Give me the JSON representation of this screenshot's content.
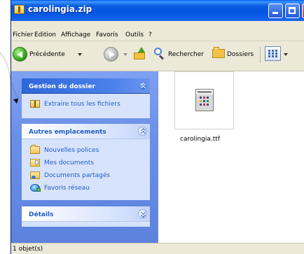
{
  "window": {
    "title": "carolingia.zip"
  },
  "menu": {
    "items": [
      "Fichier",
      "Edition",
      "Affichage",
      "Favoris",
      "Outils",
      "?"
    ]
  },
  "toolbar": {
    "back_label": "Précédente",
    "search_label": "Rechercher",
    "folders_label": "Dossiers"
  },
  "tasks": {
    "gestion_title": "Gestion du dossier",
    "gestion_items": [
      {
        "label": "Extraire tous les fichiers",
        "icon": "zip-folder-icon"
      }
    ],
    "autres_title": "Autres emplacements",
    "autres_items": [
      {
        "label": "Nouvelles polices",
        "icon": "folder-icon"
      },
      {
        "label": "Mes documents",
        "icon": "documents-folder-icon"
      },
      {
        "label": "Documents partagés",
        "icon": "shared-folder-icon"
      },
      {
        "label": "Favoris réseau",
        "icon": "network-places-icon"
      }
    ],
    "details_title": "Détails"
  },
  "main": {
    "file_name": "carolingia.ttf",
    "file_icon": "font-file-icon"
  },
  "status": {
    "text": "1 objet(s)"
  },
  "colors": {
    "titlebar": "#0a5de0",
    "task_link": "#215dc6",
    "pane_blue": "#6a8fe6",
    "chrome": "#ece9d8"
  }
}
